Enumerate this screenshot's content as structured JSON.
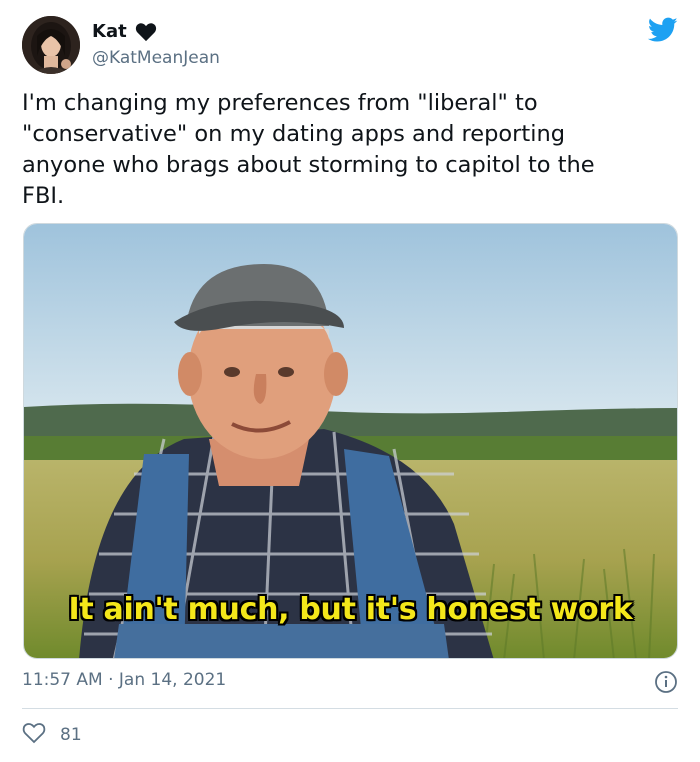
{
  "author": {
    "name": "Kat",
    "handle": "@KatMeanJean"
  },
  "tweet": {
    "text": "I'm changing my preferences from \"liberal\" to\n\"conservative\" on my dating apps and reporting\nanyone who brags about storming to capitol to the\nFBI.",
    "media_caption": "It ain't much, but it's honest work",
    "timestamp": "11:57 AM · Jan 14, 2021",
    "like_count": "81"
  },
  "colors": {
    "twitter_blue": "#1da1f2",
    "text_primary": "#0f1419",
    "text_secondary": "#5b7083",
    "caption_yellow": "#f4e71a"
  },
  "icons": {
    "verified_badge": "heart-icon",
    "brand": "twitter-bird-icon",
    "info": "info-icon",
    "like": "heart-outline-icon"
  }
}
